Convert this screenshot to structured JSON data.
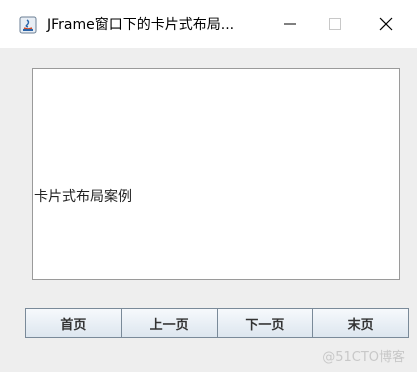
{
  "window": {
    "title": "JFrame窗口下的卡片式布局...",
    "icon": "java-icon",
    "controls": {
      "minimize": "—",
      "maximize": "□",
      "close": "✕"
    }
  },
  "card": {
    "label": "卡片式布局案例"
  },
  "buttons": [
    {
      "label": "首页"
    },
    {
      "label": "上一页"
    },
    {
      "label": "下一页"
    },
    {
      "label": "末页"
    }
  ],
  "watermark": "@51CTO博客"
}
